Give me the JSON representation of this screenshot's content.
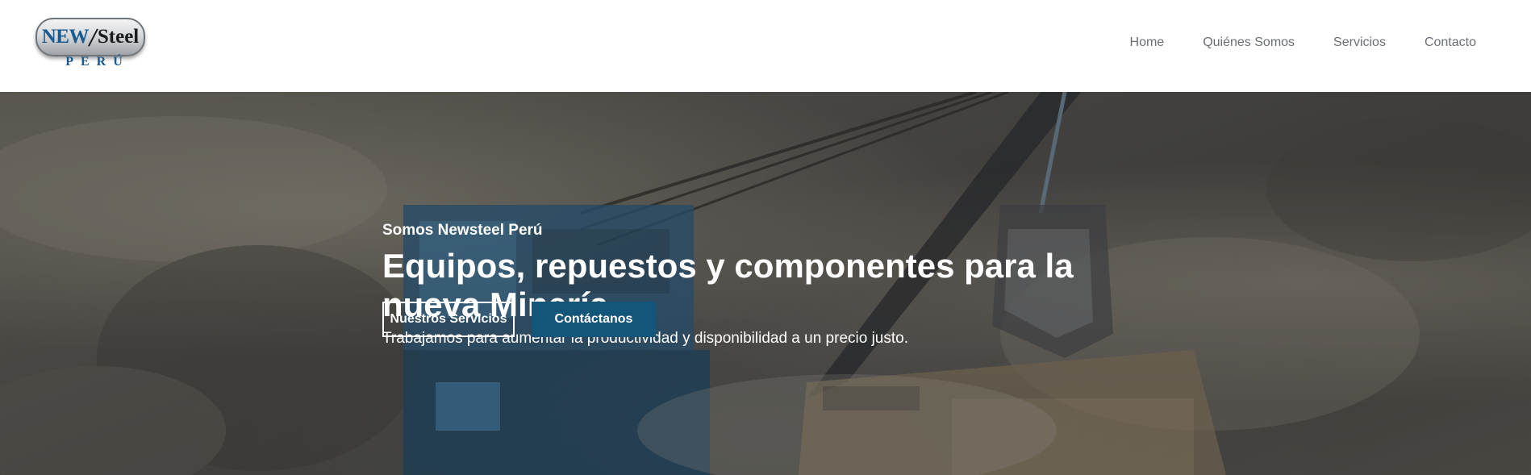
{
  "header": {
    "logo": {
      "word1": "NEW",
      "word2": "Steel",
      "country": "PERÚ"
    },
    "nav": [
      {
        "label": "Home"
      },
      {
        "label": "Quiénes Somos"
      },
      {
        "label": "Servicios"
      },
      {
        "label": "Contacto"
      }
    ]
  },
  "hero": {
    "eyebrow": "Somos Newsteel Perú",
    "headline": "Equipos, repuestos y componentes para la nueva Minería",
    "subline": "Trabajamos para aumentar la productividad y disponibilidad a un precio justo.",
    "buttons": {
      "primary": "Nuestros Servicios",
      "secondary": "Contáctanos"
    },
    "background_image": "mining shovel loading a haul truck in an open-pit mine"
  },
  "colors": {
    "brand_blue": "#14557a",
    "nav_text": "#6b6f75",
    "hero_text": "#ffffff"
  }
}
